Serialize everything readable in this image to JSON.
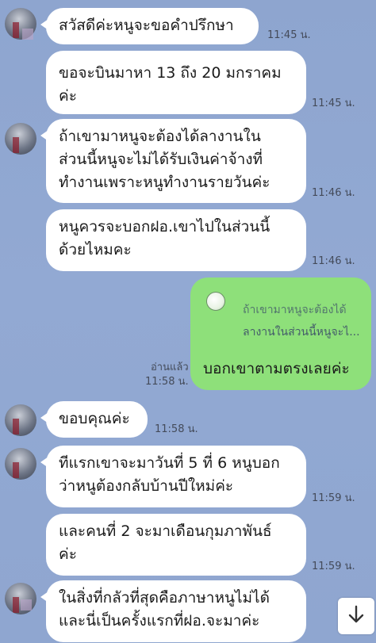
{
  "chat": {
    "messages": [
      {
        "text": "สวัสดีค่ะหนูจะขอคำปรึกษา",
        "time": "11:45 น."
      },
      {
        "text": "ขอจะบินมาหา 13 ถึง 20 มกราคม\nค่ะ",
        "time": "11:45 น."
      },
      {
        "text": "ถ้าเขามาหนูจะต้องได้ลางานใน\nส่วนนี้หนูจะไม่ได้รับเงินค่าจ้างที่\nทำงานเพราะหนูทำงานรายวันค่ะ",
        "time": "11:46 น."
      },
      {
        "text": "หนูควรจะบอกฝอ.เขาไปในส่วนนี้\nด้วยไหมคะ",
        "time": "11:46 น."
      },
      {
        "text": "ขอบคุณค่ะ",
        "time": "11:58 น."
      },
      {
        "text": "ทีแรกเขาจะมาวันที่ 5 ที่ 6 หนูบอก\nว่าหนูต้องกลับบ้านปีใหม่ค่ะ",
        "time": "11:59 น."
      },
      {
        "text": "และคนที่ 2 จะมาเดือนกุมภาพันธ์\nค่ะ",
        "time": "11:59 น."
      },
      {
        "text": "ในสิ่งที่กลัวที่สุดคือภาษาหนูไม่ได้\nและนี่เป็นครั้งแรกที่ฝอ.จะมาค่ะ",
        "time": ""
      }
    ],
    "my_reply": {
      "quote_line1": "ถ้าเขามาหนูจะต้องได้",
      "quote_line2": "ลางานในส่วนนี้หนูจะไ...",
      "text": "บอกเขาตามตรงเลยค่ะ",
      "read_label": "อ่านแล้ว",
      "time": "11:58 น."
    },
    "scroll_down_icon": "arrow-down-icon"
  }
}
